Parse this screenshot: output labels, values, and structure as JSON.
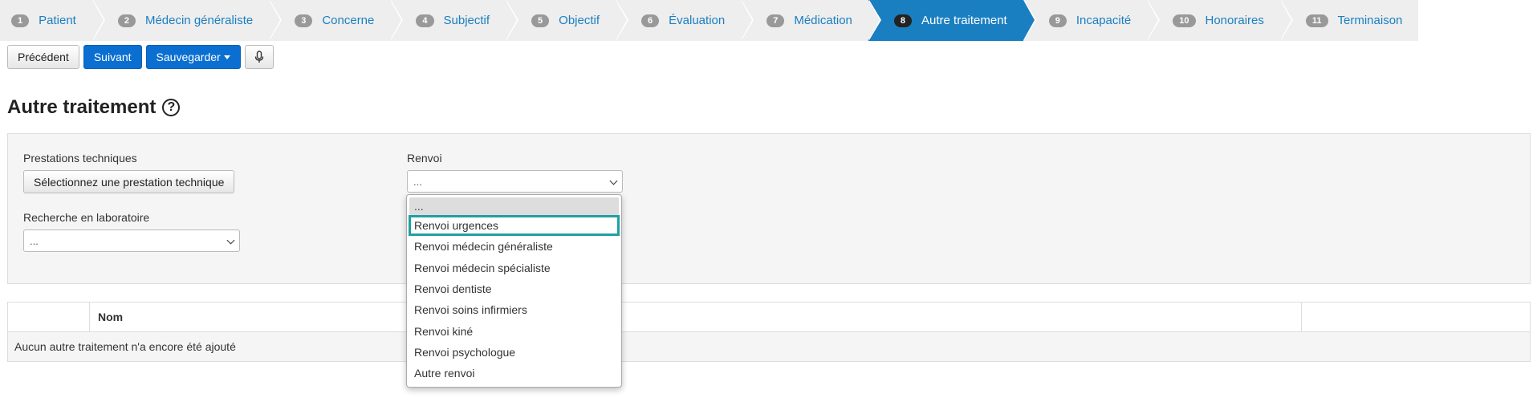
{
  "wizard": {
    "steps": [
      {
        "num": "1",
        "label": "Patient"
      },
      {
        "num": "2",
        "label": "Médecin généraliste"
      },
      {
        "num": "3",
        "label": "Concerne"
      },
      {
        "num": "4",
        "label": "Subjectif"
      },
      {
        "num": "5",
        "label": "Objectif"
      },
      {
        "num": "6",
        "label": "Évaluation"
      },
      {
        "num": "7",
        "label": "Médication"
      },
      {
        "num": "8",
        "label": "Autre traitement"
      },
      {
        "num": "9",
        "label": "Incapacité"
      },
      {
        "num": "10",
        "label": "Honoraires"
      },
      {
        "num": "11",
        "label": "Terminaison"
      }
    ],
    "active_step": "8"
  },
  "toolbar": {
    "previous_label": "Précédent",
    "next_label": "Suivant",
    "save_label": "Sauvegarder",
    "mic_icon": "microphone-icon"
  },
  "page": {
    "title": "Autre traitement",
    "help_symbol": "?"
  },
  "form": {
    "prestations_label": "Prestations techniques",
    "prestations_button": "Sélectionnez une prestation technique",
    "laboratoire_label": "Recherche en laboratoire",
    "laboratoire_value": "...",
    "renvoi_label": "Renvoi",
    "renvoi_value": "..."
  },
  "renvoi_options": [
    "...",
    "Renvoi urgences",
    "Renvoi médecin généraliste",
    "Renvoi médecin spécialiste",
    "Renvoi dentiste",
    "Renvoi soins infirmiers",
    "Renvoi kiné",
    "Renvoi psychologue",
    "Autre renvoi"
  ],
  "table": {
    "columns": [
      "",
      "Nom",
      ""
    ],
    "empty_message": "Aucun autre traitement n'a encore été ajouté"
  },
  "colors": {
    "accent": "#1a7fc1",
    "primary_button": "#0a6fd1",
    "highlight": "#1fa0a3"
  }
}
